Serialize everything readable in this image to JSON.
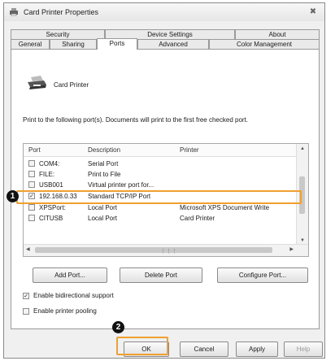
{
  "window": {
    "title": "Card Printer Properties",
    "close_label": "✖"
  },
  "tabs_top": [
    "Security",
    "Device Settings",
    "About"
  ],
  "tabs_bottom": [
    "General",
    "Sharing",
    "Ports",
    "Advanced",
    "Color Management"
  ],
  "active_tab": "Ports",
  "printer_name": "Card Printer",
  "instructions": "Print to the following port(s). Documents will print to the first free checked port.",
  "columns": [
    "Port",
    "Description",
    "Printer"
  ],
  "ports": [
    {
      "port": "COM4:",
      "description": "Serial Port",
      "printer": "",
      "checked": false
    },
    {
      "port": "FILE:",
      "description": "Print to File",
      "printer": "",
      "checked": false
    },
    {
      "port": "USB001",
      "description": "Virtual printer port for...",
      "printer": "",
      "checked": false
    },
    {
      "port": "192.168.0.33",
      "description": "Standard TCP/IP Port",
      "printer": "",
      "checked": true
    },
    {
      "port": "XPSPort:",
      "description": "Local Port",
      "printer": "Microsoft XPS Document Write",
      "checked": false
    },
    {
      "port": "CITUSB",
      "description": "Local Port",
      "printer": "Card Printer",
      "checked": false
    }
  ],
  "callouts": [
    "1",
    "2"
  ],
  "buttons": {
    "add_port": "Add Port...",
    "delete_port": "Delete Port",
    "configure_port": "Configure Port...",
    "ok": "OK",
    "cancel": "Cancel",
    "apply": "Apply",
    "help": "Help"
  },
  "options": [
    {
      "label": "Enable bidirectional support",
      "checked": true
    },
    {
      "label": "Enable printer pooling",
      "checked": false
    }
  ],
  "colors": {
    "highlight": "#f0a030"
  },
  "icons": [
    "printer-icon",
    "close-icon",
    "scroll-up-icon",
    "scroll-down-icon",
    "scroll-left-icon",
    "scroll-right-icon"
  ]
}
